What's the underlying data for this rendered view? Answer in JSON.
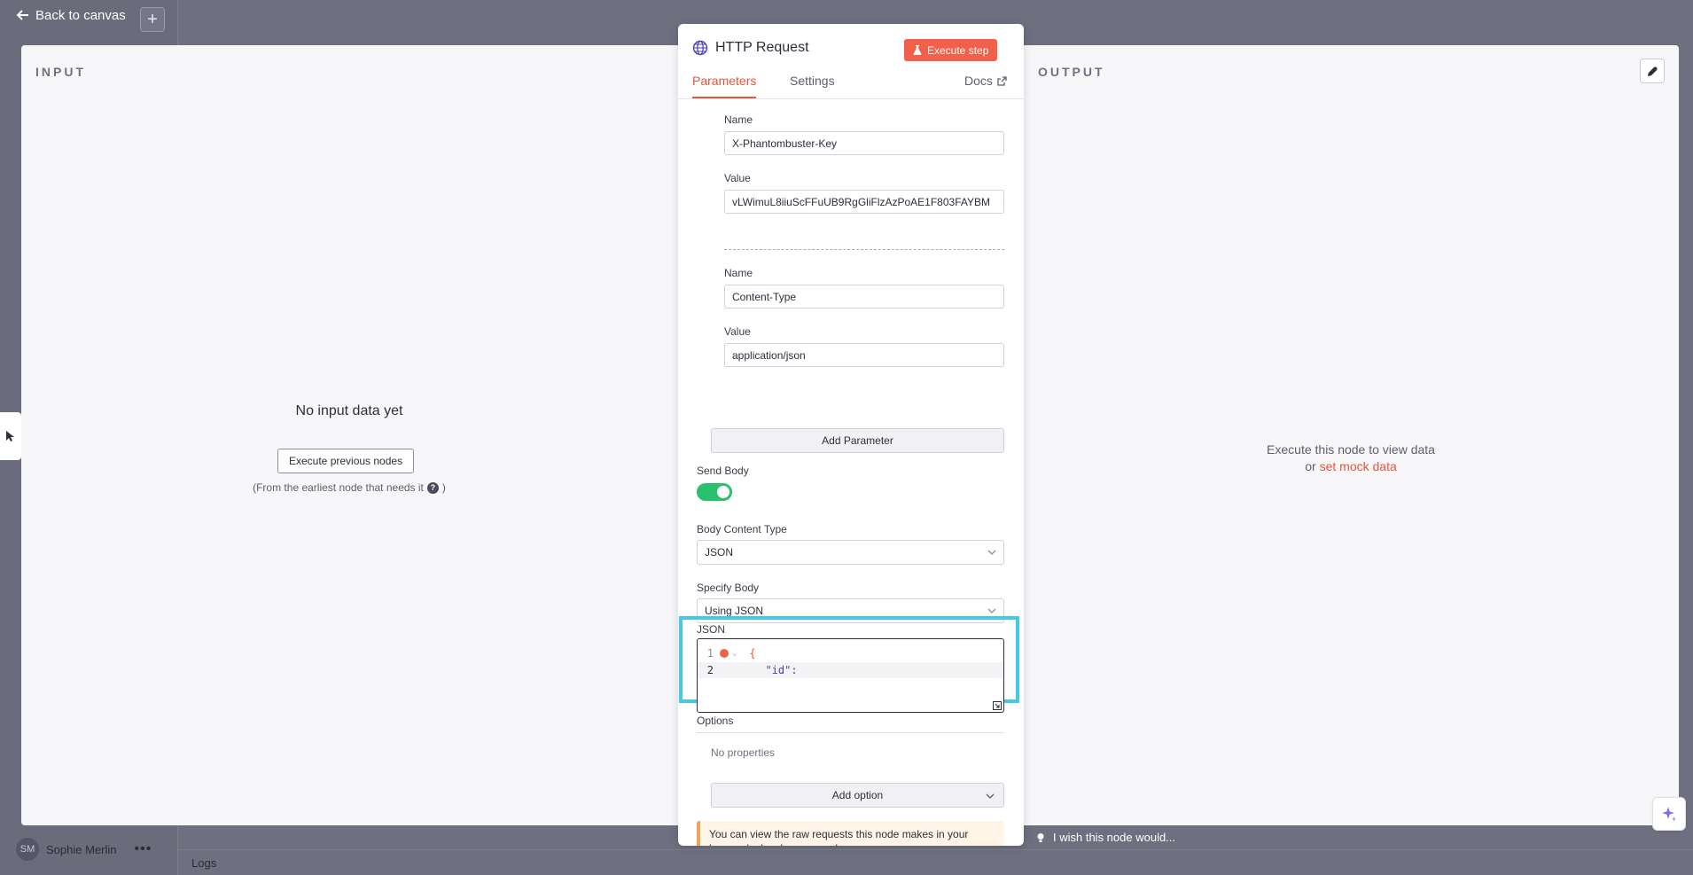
{
  "background": {
    "back_label": "Back to canvas",
    "add_label": "+",
    "user_initials": "SM",
    "user_name": "Sophie Merlin",
    "more": "•••",
    "logs_label": "Logs",
    "wish_label": "I wish this node would..."
  },
  "input_panel": {
    "label": "INPUT",
    "empty_title": "No input data yet",
    "exec_prev_label": "Execute previous nodes",
    "hint_prefix": "(From the earliest node that needs it",
    "hint_suffix": ")",
    "help_glyph": "?"
  },
  "output_panel": {
    "label": "OUTPUT",
    "empty_line1": "Execute this node to view data",
    "empty_or": "or",
    "mock_link": "set mock data"
  },
  "node": {
    "title": "HTTP Request",
    "execute_label": "Execute step",
    "tabs": {
      "parameters": "Parameters",
      "settings": "Settings",
      "docs": "Docs"
    },
    "headers": [
      {
        "name_label": "Name",
        "name_value": "X-Phantombuster-Key",
        "value_label": "Value",
        "value_value": "vLWimuL8iiuScFFuUB9RgGliFlzAzPoAE1F803FAYBM"
      },
      {
        "name_label": "Name",
        "name_value": "Content-Type",
        "value_label": "Value",
        "value_value": "application/json"
      }
    ],
    "add_parameter_label": "Add Parameter",
    "send_body_label": "Send Body",
    "send_body_on": true,
    "body_content_type_label": "Body Content Type",
    "body_content_type_value": "JSON",
    "specify_body_label": "Specify Body",
    "specify_body_value": "Using JSON",
    "json_label": "JSON",
    "json_lines": [
      {
        "no": "1",
        "text": "{"
      },
      {
        "no": "2",
        "text": "  \"id\":"
      }
    ],
    "options_label": "Options",
    "no_properties": "No properties",
    "add_option_label": "Add option",
    "notice_text": "You can view the raw requests this node makes in your browser's developer console"
  },
  "colors": {
    "accent": "#e5553b",
    "execute_bg": "#f0604a",
    "toggle_on": "#29c16d",
    "focus_highlight": "#46c8e8"
  }
}
